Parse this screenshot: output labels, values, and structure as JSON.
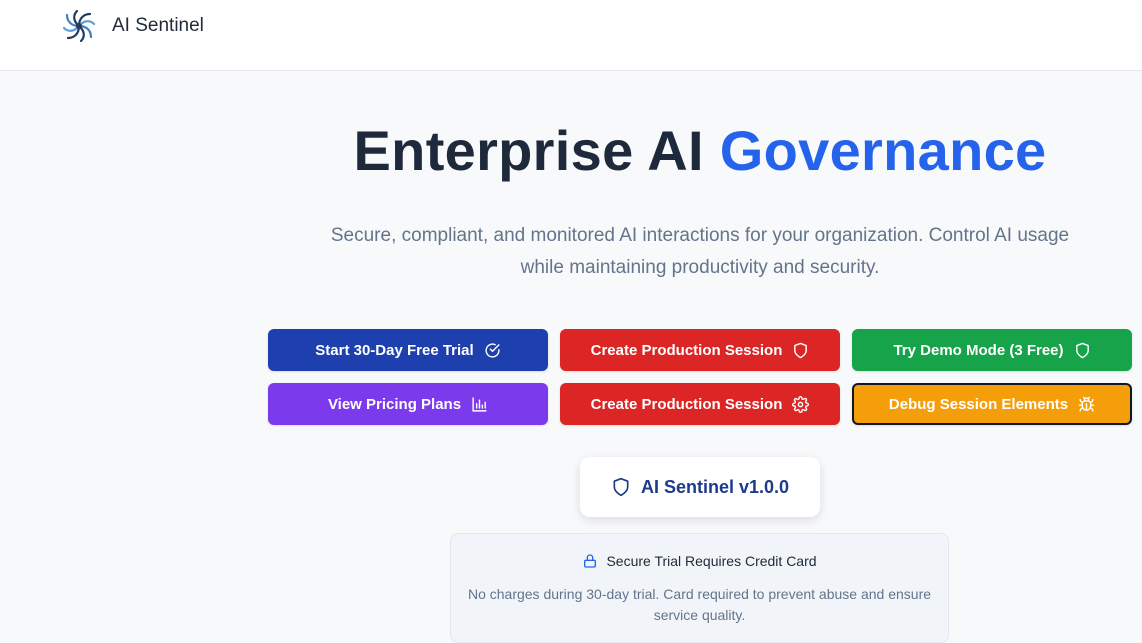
{
  "header": {
    "brand": "AI Sentinel",
    "logo_icon": "aperture-swirl-icon"
  },
  "hero": {
    "title_main": "Enterprise AI ",
    "title_accent": "Governance",
    "subtitle": "Secure, compliant, and monitored AI interactions for your organization. Control AI usage while maintaining productivity and security."
  },
  "buttons": [
    {
      "label": "Start 30-Day Free Trial",
      "icon": "check-circle-icon",
      "color": "#1e40af"
    },
    {
      "label": "Create Production Session",
      "icon": "shield-icon",
      "color": "#dc2626"
    },
    {
      "label": "Try Demo Mode (3 Free)",
      "icon": "shield-icon",
      "color": "#16a34a"
    },
    {
      "label": "View Pricing Plans",
      "icon": "bar-chart-icon",
      "color": "#7c3aed"
    },
    {
      "label": "Create Production Session",
      "icon": "gear-icon",
      "color": "#dc2626"
    },
    {
      "label": "Debug Session Elements",
      "icon": "bug-icon",
      "color": "#f59e0b"
    }
  ],
  "version_badge": {
    "label": "AI Sentinel v1.0.0",
    "icon": "shield-icon"
  },
  "trial_notice": {
    "title": "Secure Trial Requires Credit Card",
    "icon": "lock-icon",
    "text": "No charges during 30-day trial. Card required to prevent abuse and ensure service quality."
  },
  "colors": {
    "accent": "#2563eb",
    "heading": "#1e293b",
    "muted": "#64748b",
    "background": "#f7f9fb"
  }
}
